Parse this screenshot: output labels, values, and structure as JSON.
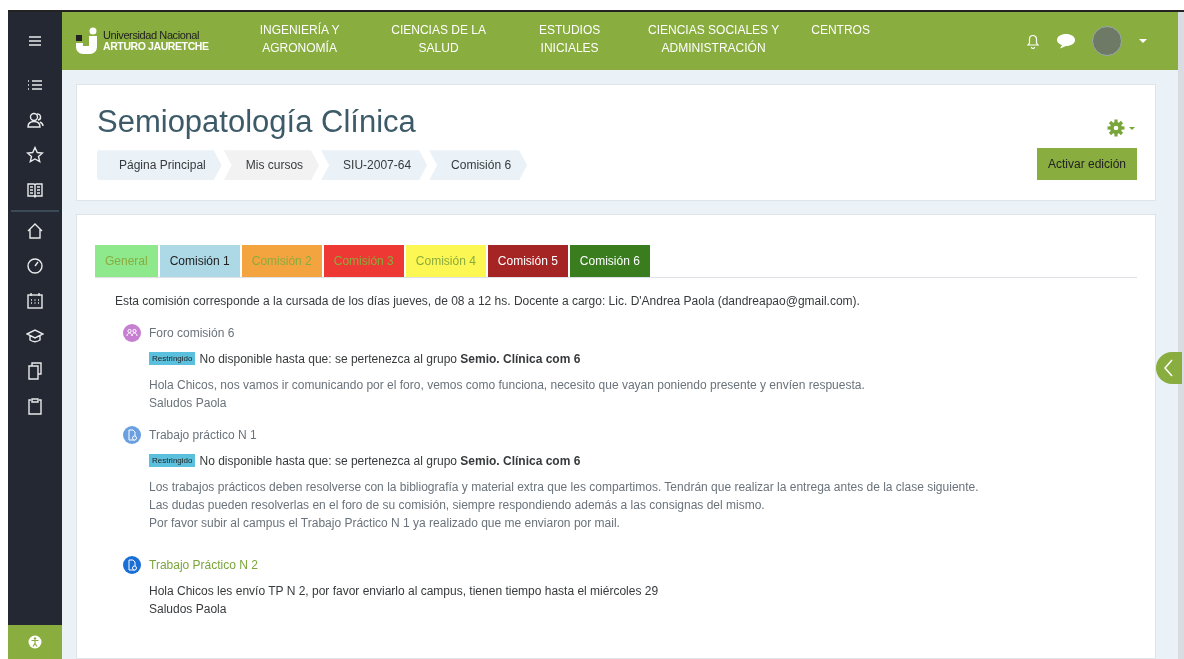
{
  "navbar": {
    "logo": {
      "line1": "Universidad Nacional",
      "line2": "ARTURO JAURETCHE"
    },
    "menu": [
      {
        "label": "INGENIERÍA Y AGRONOMÍA"
      },
      {
        "label": "CIENCIAS DE LA SALUD"
      },
      {
        "label": "ESTUDIOS INICIALES"
      },
      {
        "label": "CIENCIAS SOCIALES Y ADMINISTRACIÓN"
      },
      {
        "label": "CENTROS"
      }
    ]
  },
  "header": {
    "title": "Semiopatología Clínica",
    "breadcrumb": [
      {
        "label": "Página Principal"
      },
      {
        "label": "Mis cursos"
      },
      {
        "label": "SIU-2007-64"
      },
      {
        "label": "Comisión 6"
      }
    ],
    "edit_button": "Activar edición"
  },
  "tabs": [
    {
      "label": "General",
      "color": "#8ee88c",
      "kind": "link"
    },
    {
      "label": "Comisión 1",
      "color": "#add8e6",
      "kind": "dark"
    },
    {
      "label": "Comisión 2",
      "color": "#f3a43f",
      "kind": "link"
    },
    {
      "label": "Comisión 3",
      "color": "#ee3833",
      "kind": "link"
    },
    {
      "label": "Comisión 4",
      "color": "#fcf752",
      "kind": "link"
    },
    {
      "label": "Comisión 5",
      "color": "#a52524",
      "kind": "light"
    },
    {
      "label": "Comisión 6",
      "color": "#3a7d1e",
      "kind": "light"
    }
  ],
  "summary": "Esta comisión corresponde a la cursada de los días jueves, de 08 a 12 hs. Docente a cargo: Lic. D'Andrea Paola (dandreapao@gmail.com).",
  "activities": [
    {
      "kind": "forum",
      "title": "Foro comisión 6",
      "available": false,
      "restriction": {
        "badge": "Restringido",
        "text": "No disponible hasta que: se pertenezca al grupo **Semio. Clínica com 6**"
      },
      "description": [
        "Hola Chicos, nos vamos ir comunicando por el foro, vemos como funciona, necesito que vayan poniendo presente y envíen respuesta.",
        "Saludos Paola"
      ]
    },
    {
      "kind": "assign",
      "title": "Trabajo práctico N 1",
      "available": false,
      "restriction": {
        "badge": "Restringido",
        "text": "No disponible hasta que: se pertenezca al grupo **Semio. Clínica com 6**"
      },
      "description": [
        "Los trabajos prácticos deben resolverse con la bibliografía y material extra que les compartimos. Tendrán que realizar la entrega antes de la clase siguiente.",
        "Las dudas pueden resolverlas en el foro de su comisión, siempre respondiendo además a las consignas del mismo.",
        "Por favor subir al campus el Trabajo Práctico N 1 ya realizado que me enviaron por mail."
      ]
    },
    {
      "kind": "assign",
      "title": "Trabajo Práctico N 2",
      "available": true,
      "description": [
        "Hola Chicos les envío TP N 2, por favor enviarlo al campus, tienen tiempo hasta el miércoles 29",
        "Saludos Paola"
      ]
    }
  ]
}
